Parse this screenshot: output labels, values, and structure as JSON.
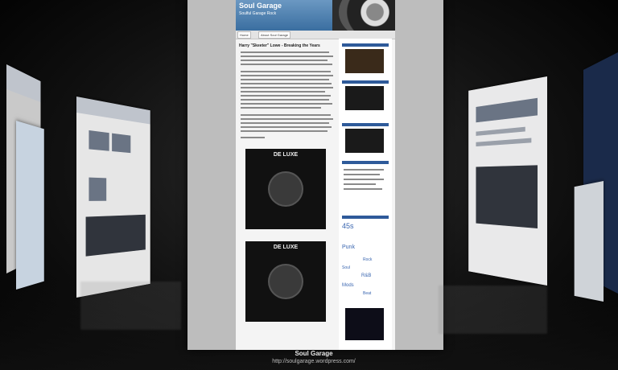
{
  "caption": {
    "title": "Soul Garage",
    "url": "http://soulgarage.wordpress.com/"
  },
  "page": {
    "site_title": "Soul Garage",
    "tagline": "Soulful Garage Rock",
    "nav": [
      "Home",
      "About Soul Garage"
    ],
    "post_title": "Harry \"Skeeter\" Lowe - Breaking the Years",
    "record_label": "DE LUXE",
    "sidebar_tags": [
      "45s",
      "Punk",
      "Rock",
      "Soul",
      "R&B",
      "Mods",
      "Beat"
    ]
  },
  "colors": {
    "accent": "#2e5a9a",
    "background": "#000000"
  },
  "icons": [
    "tire-graphic",
    "vinyl-record-icon"
  ]
}
